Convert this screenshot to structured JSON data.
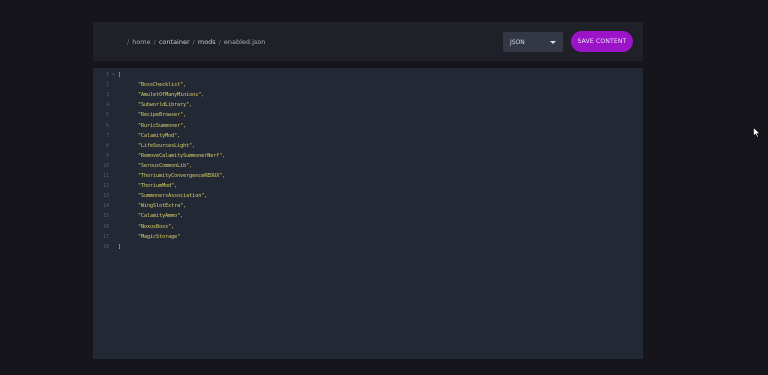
{
  "breadcrumb": {
    "segments": [
      "home",
      "container",
      "mods",
      "enabled.json"
    ]
  },
  "toolbar": {
    "format_select": {
      "selected": "JSON"
    },
    "save_label": "SAVE CONTENT"
  },
  "editor": {
    "open_bracket": "[",
    "close_bracket": "]",
    "line_numbers": [
      "1",
      "2",
      "3",
      "4",
      "5",
      "6",
      "7",
      "8",
      "9",
      "10",
      "11",
      "12",
      "13",
      "14",
      "15",
      "16",
      "17",
      "18"
    ],
    "entries": [
      "\"BossChecklist\",",
      "\"AmuletOfManyMinions\",",
      "\"SubworldLibrary\",",
      "\"RecipeBrowser\",",
      "\"RuricSummoner\",",
      "\"CalamityMod\",",
      "\"LifeSourcesLight\",",
      "\"RemoveCalamitySummonerNerf\",",
      "\"SerousCommonLib\",",
      "\"ThoriumityConvergenceREDUX\",",
      "\"ThoriumMod\",",
      "\"SummonersAssociation\",",
      "\"WingSlotExtra\",",
      "\"CalamityAmmo\",",
      "\"NoxusBoss\",",
      "\"MagicStorage\""
    ]
  },
  "colors": {
    "accent": "#9b14c7",
    "string": "#e0d36a",
    "editor_bg": "#232934"
  }
}
